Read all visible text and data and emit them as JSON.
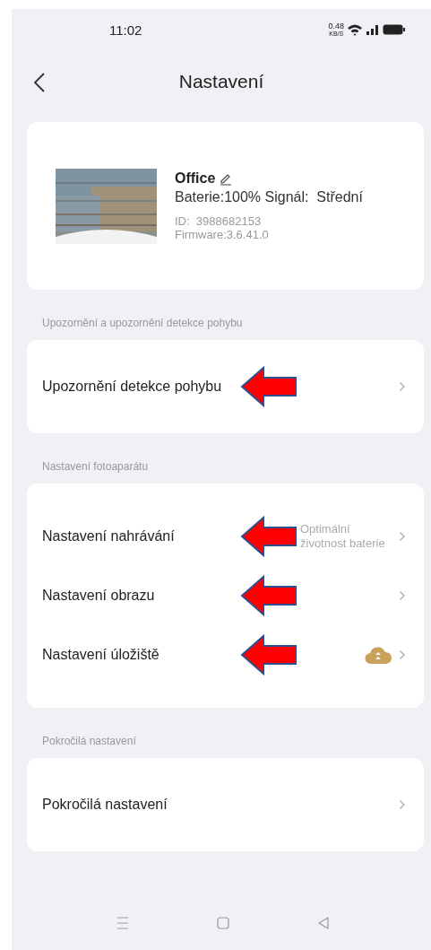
{
  "status_bar": {
    "time": "11:02",
    "speed_value": "0.48",
    "speed_unit": "KB/S"
  },
  "header": {
    "title": "Nastavení"
  },
  "device": {
    "kind": "picture",
    "name": "Office",
    "battery_signal": "Baterie:100% Signál:  Střední",
    "id": "ID:  3988682153",
    "firmware": "Firmware:3.6.41.0"
  },
  "sections": [
    {
      "label": "Upozornění a upozornění detekce pohybu",
      "rows": [
        {
          "label": "Upozornění detekce pohybu",
          "annotation_arrow": true
        }
      ]
    },
    {
      "label": "Nastavení fotoaparátu",
      "rows": [
        {
          "label": "Nastavení nahrávání",
          "value": "Optimální životnost baterie",
          "annotation_arrow": true
        },
        {
          "label": "Nastavení obrazu",
          "annotation_arrow": true
        },
        {
          "label": "Nastavení úložiště",
          "cloud_badge": true,
          "annotation_arrow": true
        }
      ]
    },
    {
      "label": "Pokročilá nastavení",
      "rows": [
        {
          "label": "Pokročilá nastavení",
          "annotation_arrow": false
        }
      ]
    }
  ]
}
